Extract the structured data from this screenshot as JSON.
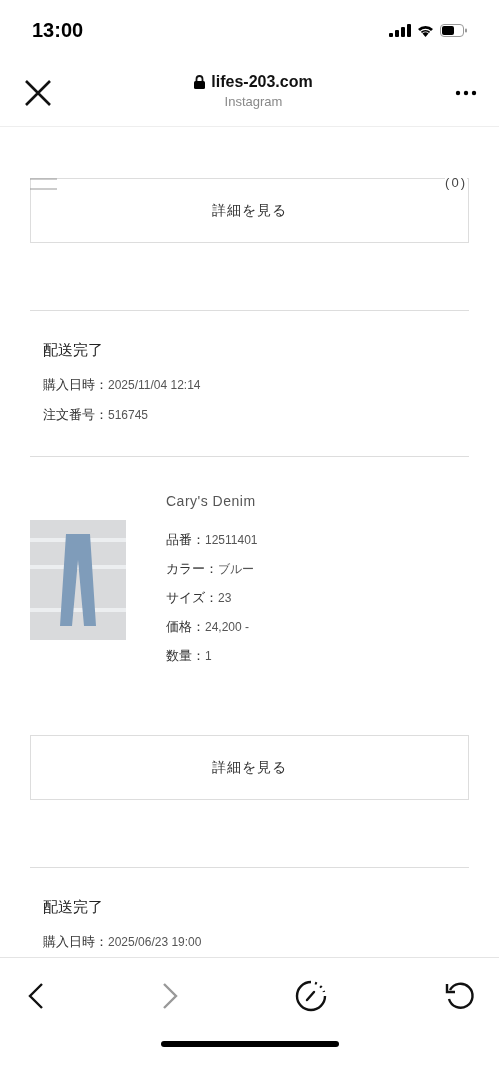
{
  "status_bar": {
    "time": "13:00"
  },
  "browser_header": {
    "domain": "lifes-203.com",
    "source": "Instagram"
  },
  "top_partial": {
    "count": "(0)",
    "button": "詳細を見る"
  },
  "orders": [
    {
      "status": "配送完了",
      "details": [
        {
          "label": "購入日時：",
          "value": "2025/11/04 12:14"
        },
        {
          "label": "注文番号：",
          "value": "516745"
        }
      ],
      "items": [
        {
          "name": "Cary's Denim",
          "details": [
            {
              "label": "品番：",
              "value": "12511401"
            },
            {
              "label": "カラー：",
              "value": "ブルー"
            },
            {
              "label": "サイズ：",
              "value": "23"
            },
            {
              "label": "価格：",
              "value": "24,200 -"
            },
            {
              "label": "数量：",
              "value": "1"
            }
          ]
        }
      ],
      "button": "詳細を見る"
    },
    {
      "status": "配送完了",
      "details": [
        {
          "label": "購入日時：",
          "value": "2025/06/23 19:00"
        }
      ]
    }
  ],
  "toolbar": [
    {
      "kind": "back",
      "disabled": false
    },
    {
      "kind": "forward",
      "disabled": true
    },
    {
      "kind": "timer",
      "disabled": false
    },
    {
      "kind": "reload",
      "disabled": false
    }
  ]
}
